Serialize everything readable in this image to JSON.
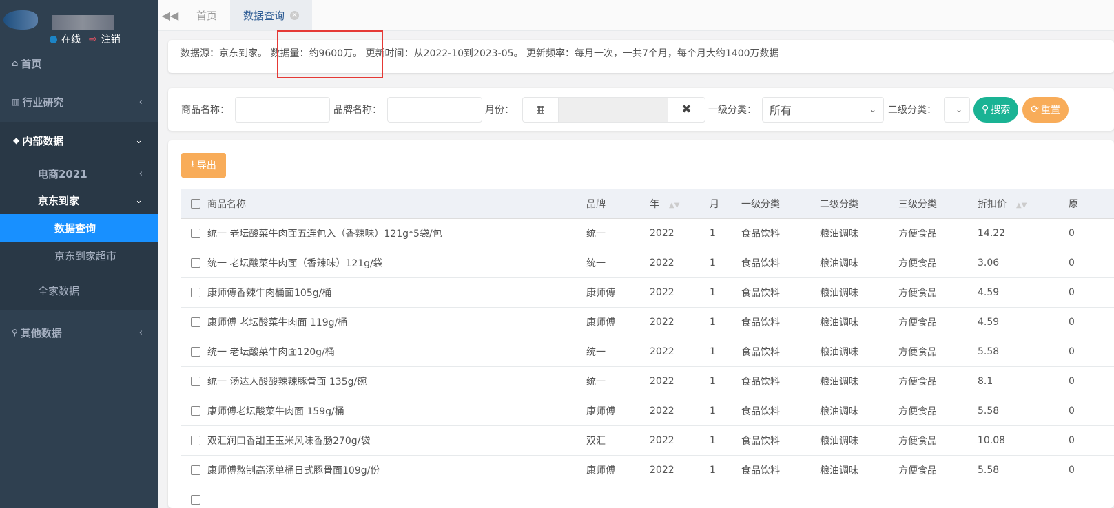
{
  "sidebar": {
    "status": "在线",
    "logout": "注销",
    "items": [
      {
        "label": "首页"
      },
      {
        "label": "行业研究"
      },
      {
        "label": "内部数据"
      },
      {
        "label": "电商2021"
      },
      {
        "label": "京东到家"
      },
      {
        "label": "数据查询"
      },
      {
        "label": "京东到家超市"
      },
      {
        "label": "全家数据"
      },
      {
        "label": "其他数据"
      }
    ]
  },
  "tabs": [
    {
      "label": "首页"
    },
    {
      "label": "数据查询"
    }
  ],
  "info": {
    "source": "数据源：京东到家。",
    "volume": "数据量：约9600万。",
    "update": "更新时间：从2022-10到2023-05。",
    "freq": "更新频率：每月一次，一共7个月，每个月大约1400万数据"
  },
  "filters": {
    "product_label": "商品名称：",
    "brand_label": "品牌名称：",
    "month_label": "月份：",
    "cat1_label": "一级分类：",
    "cat1_value": "所有",
    "cat2_label": "二级分类：",
    "search": "搜索",
    "reset": "重置"
  },
  "export": "导出",
  "columns": [
    "商品名称",
    "品牌",
    "年",
    "月",
    "一级分类",
    "二级分类",
    "三级分类",
    "折扣价",
    "原"
  ],
  "rows": [
    [
      "统一 老坛酸菜牛肉面五连包入（香辣味）121g*5袋/包",
      "统一",
      "2022",
      "1",
      "食品饮料",
      "粮油调味",
      "方便食品",
      "14.22",
      "0"
    ],
    [
      "统一 老坛酸菜牛肉面（香辣味）121g/袋",
      "统一",
      "2022",
      "1",
      "食品饮料",
      "粮油调味",
      "方便食品",
      "3.06",
      "0"
    ],
    [
      "康师傅香辣牛肉桶面105g/桶",
      "康师傅",
      "2022",
      "1",
      "食品饮料",
      "粮油调味",
      "方便食品",
      "4.59",
      "0"
    ],
    [
      "康师傅 老坛酸菜牛肉面 119g/桶",
      "康师傅",
      "2022",
      "1",
      "食品饮料",
      "粮油调味",
      "方便食品",
      "4.59",
      "0"
    ],
    [
      "统一 老坛酸菜牛肉面120g/桶",
      "统一",
      "2022",
      "1",
      "食品饮料",
      "粮油调味",
      "方便食品",
      "5.58",
      "0"
    ],
    [
      "统一 汤达人酸酸辣辣豚骨面 135g/碗",
      "统一",
      "2022",
      "1",
      "食品饮料",
      "粮油调味",
      "方便食品",
      "8.1",
      "0"
    ],
    [
      "康师傅老坛酸菜牛肉面 159g/桶",
      "康师傅",
      "2022",
      "1",
      "食品饮料",
      "粮油调味",
      "方便食品",
      "5.58",
      "0"
    ],
    [
      "双汇润口香甜王玉米风味香肠270g/袋",
      "双汇",
      "2022",
      "1",
      "食品饮料",
      "粮油调味",
      "方便食品",
      "10.08",
      "0"
    ],
    [
      "康师傅熬制高汤单桶日式豚骨面109g/份",
      "康师傅",
      "2022",
      "1",
      "食品饮料",
      "粮油调味",
      "方便食品",
      "5.58",
      "0"
    ]
  ]
}
